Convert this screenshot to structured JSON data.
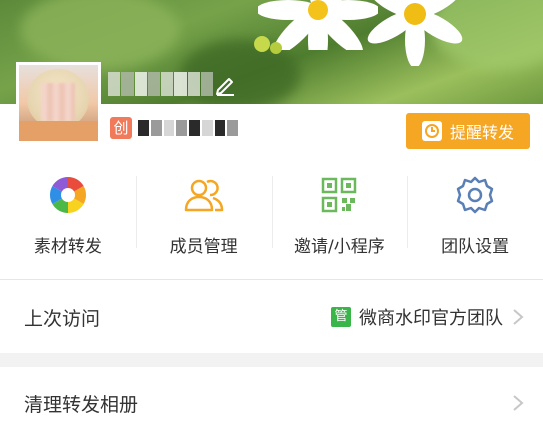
{
  "profile": {
    "creator_badge": "创",
    "remind_button_label": "提醒转发"
  },
  "menu": [
    {
      "label": "素材转发",
      "icon": "aperture-icon"
    },
    {
      "label": "成员管理",
      "icon": "members-icon"
    },
    {
      "label": "邀请/小程序",
      "icon": "qrcode-icon"
    },
    {
      "label": "团队设置",
      "icon": "gear-icon"
    }
  ],
  "last_visit": {
    "title": "上次访问",
    "badge": "管",
    "team_name": "微商水印官方团队"
  },
  "clean_album": {
    "title": "清理转发相册"
  },
  "colors": {
    "accent_orange": "#f5a623",
    "manage_green": "#39b54a",
    "creator_red": "#f07a5a"
  }
}
